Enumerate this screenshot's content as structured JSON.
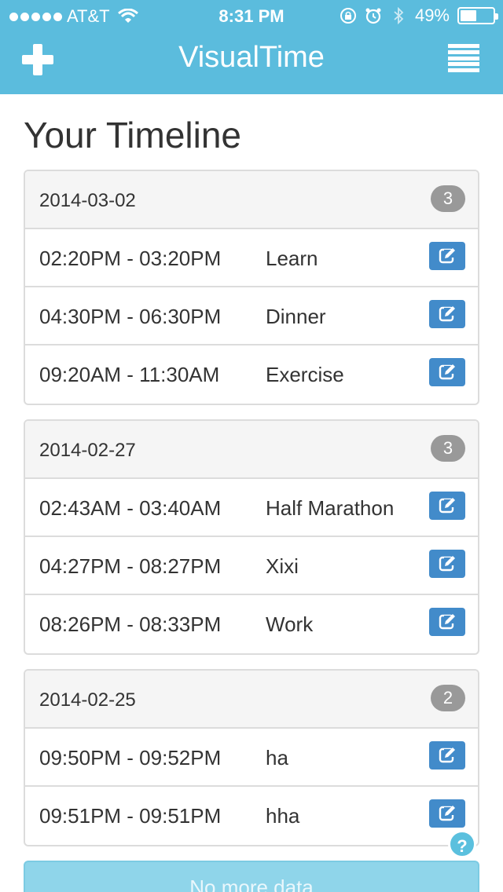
{
  "status_bar": {
    "carrier": "AT&T",
    "time": "8:31 PM",
    "battery_text": "49%",
    "battery_level": 0.49,
    "icons": [
      "signal-dots-icon",
      "wifi-icon",
      "rotation-lock-icon",
      "alarm-icon",
      "bluetooth-icon",
      "battery-icon"
    ]
  },
  "nav": {
    "title": "VisualTime",
    "add_icon": "plus-icon",
    "menu_icon": "menu-icon"
  },
  "page": {
    "title": "Your Timeline"
  },
  "days": [
    {
      "date": "2014-03-02",
      "count": "3",
      "entries": [
        {
          "time": "02:20PM - 03:20PM",
          "label": "Learn"
        },
        {
          "time": "04:30PM - 06:30PM",
          "label": "Dinner"
        },
        {
          "time": "09:20AM - 11:30AM",
          "label": "Exercise"
        }
      ]
    },
    {
      "date": "2014-02-27",
      "count": "3",
      "entries": [
        {
          "time": "02:43AM - 03:40AM",
          "label": "Half Marathon"
        },
        {
          "time": "04:27PM - 08:27PM",
          "label": "Xixi"
        },
        {
          "time": "08:26PM - 08:33PM",
          "label": "Work"
        }
      ]
    },
    {
      "date": "2014-02-25",
      "count": "2",
      "entries": [
        {
          "time": "09:50PM - 09:52PM",
          "label": "ha"
        },
        {
          "time": "09:51PM - 09:51PM",
          "label": "hha"
        }
      ]
    }
  ],
  "help_label": "?",
  "more_button": "No more data",
  "colors": {
    "header": "#5bbcdd",
    "edit_button": "#428bca",
    "badge": "#999999",
    "more_button": "#8fd5ea"
  }
}
